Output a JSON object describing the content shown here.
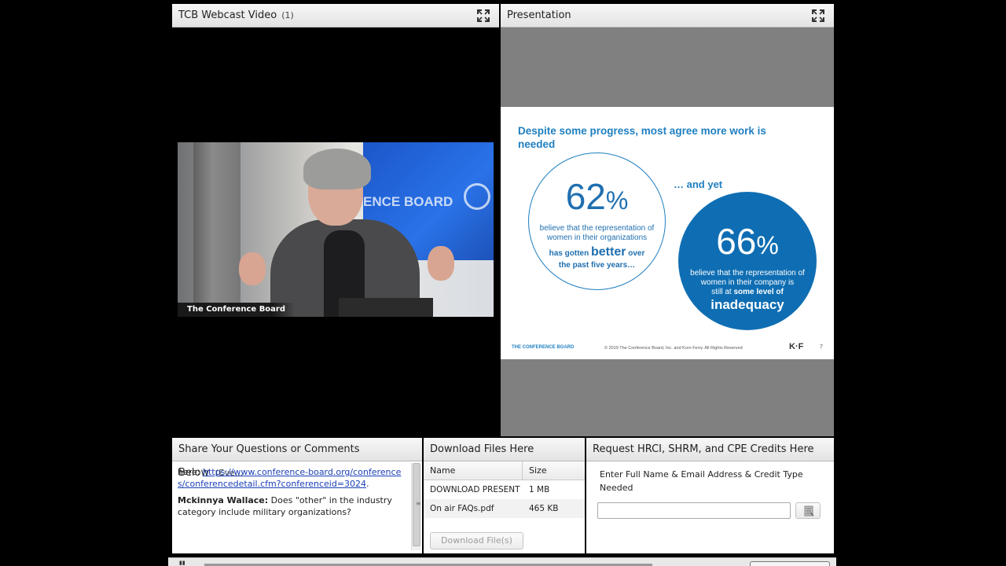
{
  "video_pod": {
    "title": "TCB Webcast Video",
    "count": "(1)",
    "caption": "The Conference Board",
    "screen_text": "ENCE BOARD"
  },
  "presentation_pod": {
    "title": "Presentation",
    "slide": {
      "title": "Despite some progress, most agree more work is needed",
      "left_stat": {
        "number": "62",
        "unit": "%",
        "text": "believe that the representation of women in their organizations",
        "emph_prefix": "has gotten",
        "emph_word": "better",
        "emph_suffix": "over",
        "tail": "the past five years…"
      },
      "connector": "… and yet",
      "right_stat": {
        "number": "66",
        "unit": "%",
        "text": "believe that the representation of women in their company is",
        "emph_prefix": "still at",
        "emph_word": "some level of",
        "big_word": "inadequacy"
      },
      "footer_logo": "THE CONFERENCE BOARD",
      "footer_copyright": "© 2019 The Conference Board, Inc. and Korn Ferry. All Rights Reserved",
      "footer_mark": "K·F",
      "page_number": "7"
    }
  },
  "chat_pod": {
    "title": "Share Your Questions or Comments Below",
    "tab_more": "(Eve...",
    "messages": {
      "prev_prefix": "here: ",
      "prev_link": "https://www.conference-board.org/conferences/conferencedetail.cfm?conferenceid=3024",
      "prev_suffix": ".",
      "sender": "Mckinnya Wallace:",
      "text": "Does \"other\" in the industry category include military organizations?"
    }
  },
  "files_pod": {
    "title": "Download Files Here",
    "columns": [
      "Name",
      "Size"
    ],
    "rows": [
      {
        "name": "DOWNLOAD PRESENT",
        "size": "1 MB"
      },
      {
        "name": "On air FAQs.pdf",
        "size": "465 KB"
      }
    ],
    "button": "Download File(s)"
  },
  "credits_pod": {
    "title": "Request HRCI, SHRM, and CPE Credits Here",
    "label": "Enter Full Name & Email Address & Credit Type Needed",
    "input_value": ""
  },
  "colors": {
    "slide_blue": "#1f7fc0",
    "circle_fill": "#0f6eb3",
    "link": "#1a3fb5"
  },
  "icons": [
    "expand-icon",
    "send-icon",
    "grip-icon"
  ]
}
